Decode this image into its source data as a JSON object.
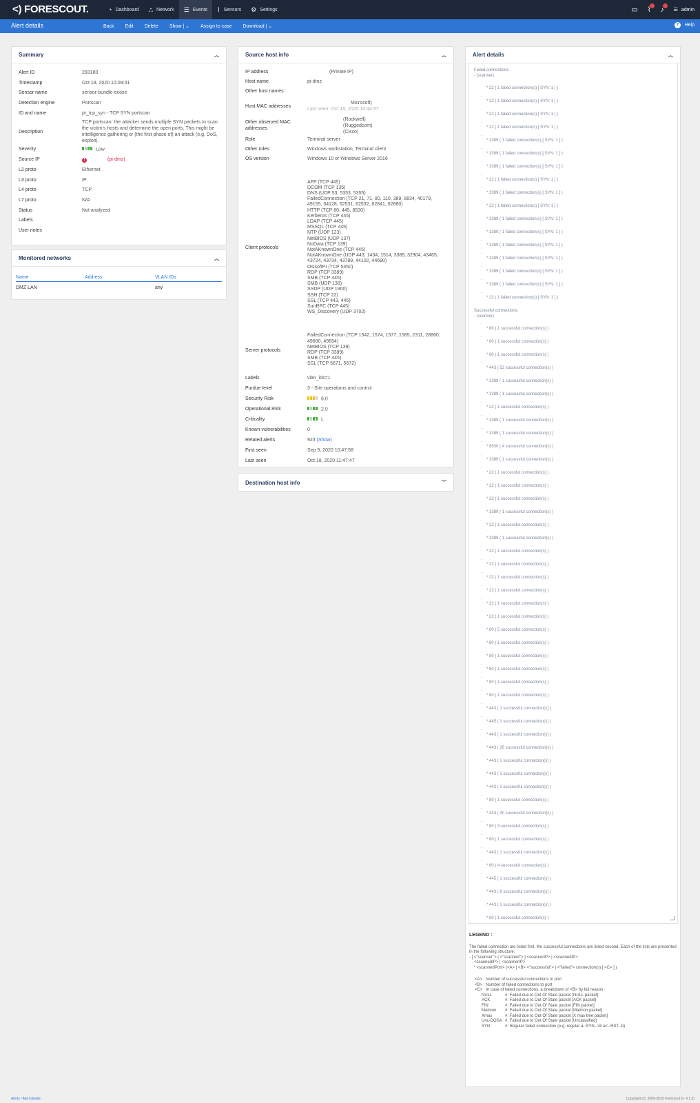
{
  "app": {
    "logo": "<) FORESCOUT."
  },
  "nav": [
    {
      "icon": "dashboard-icon",
      "glyph": "◔",
      "label": "Dashboard"
    },
    {
      "icon": "network-icon",
      "glyph": "⛬",
      "label": "Network"
    },
    {
      "icon": "events-icon",
      "glyph": "☰",
      "label": "Events",
      "active": true
    },
    {
      "icon": "sensors-icon",
      "glyph": "⌇",
      "label": "Sensors"
    },
    {
      "icon": "settings-icon",
      "glyph": "⚙",
      "label": "Settings"
    }
  ],
  "user": {
    "name": "admin"
  },
  "actionbar": {
    "title": "Alert details",
    "actions": [
      "Back",
      "Edit",
      "Delete",
      "Show | ⌄",
      "Assign to case",
      "Download | ⌄"
    ],
    "help": "Help"
  },
  "summary": {
    "title": "Summary",
    "fields": [
      {
        "k": "Alert ID",
        "v": "283180"
      },
      {
        "k": "Timestamp",
        "v": "Oct 18, 2020 10:09:41"
      },
      {
        "k": "Sensor name",
        "v": "sensor-bundle-ecose",
        "link": true
      },
      {
        "k": "Detection engine",
        "v": "Portscan"
      },
      {
        "k": "ID and name",
        "v": "pt_tcp_syn - TCP SYN portscan"
      },
      {
        "k": "Description",
        "v": "TCP portscan: the attacker sends multiple SYN packets to scan the victim's hosts and determine the open ports. This might be intelligence gathering or (the first phase of) an attack (e.g. DoS, exploit)."
      },
      {
        "k": "Severity",
        "v": "Low",
        "bars": "low"
      },
      {
        "k": "Source IP",
        "v": "(pi-dmz)",
        "danger": true
      },
      {
        "k": "L2 proto",
        "v": "Ethernet"
      },
      {
        "k": "L3 proto",
        "v": "IP"
      },
      {
        "k": "L4 proto",
        "v": "TCP"
      },
      {
        "k": "L7 proto",
        "v": "N/A"
      },
      {
        "k": "Status",
        "v": "Not analyzed"
      },
      {
        "k": "Labels",
        "v": ""
      },
      {
        "k": "User notes",
        "v": ""
      }
    ]
  },
  "monitored": {
    "title": "Monitored networks",
    "headers": [
      "Name",
      "Address",
      "VLAN IDs"
    ],
    "rows": [
      [
        "DMZ LAN",
        "",
        "any"
      ]
    ]
  },
  "source": {
    "title": "Source host info",
    "ip": "(Private IP)",
    "host": "pi-dmz",
    "mac_vendor": "Microsoft)",
    "mac_seen": "Last seen: Oct 18, 2020 10:44:57",
    "other_macs": [
      "(Rockwell)",
      "(Ruggedcom)",
      "(Cisco)"
    ],
    "role": "Terminal server",
    "other_roles": "Windows workstation, Terminal client",
    "os": "Windows 10 or Windows Server 2016",
    "client_protocols": [
      "AFP (TCP 445)",
      "DCOM (TCP 135)",
      "DNS (UDP 53, 5353, 5355)",
      "FailedConnection (TCP 21, 71, 80, 110, 389, 8834, 40179, 49155, 54128, 62531, 62532, 62841, 62880)",
      "HTTP (TCP 80, 445, 8530)",
      "Kerberos (TCP 445)",
      "LDAP (TCP 445)",
      "MSSQL (TCP 445)",
      "NTP (UDP 123)",
      "NetBIOS (UDP 137)",
      "NoData (TCP 139)",
      "NotAKnownOne (TCP 445)",
      "NotAKnownOne (UDP 443, 1434, 1514, 3389, 32904, 43465, 43724, 43734, 43789, 44102, 44690)",
      "OsisoftPI (TCP 5450)",
      "RDP (TCP 3389)",
      "SMB (TCP 445)",
      "SMB (UDP 138)",
      "SSDP (UDP 1900)",
      "SSH (TCP 22)",
      "SSL (TCP 443, 445)",
      "SunRPC (TCP 445)",
      "WS_Discovery (UDP 3702)"
    ],
    "server_protocols": [
      "FailedConnection (TCP 1542, 1574, 1577, 1585, 2311, 28860, 49680, 49694)",
      "NetBIOS (TCP 139)",
      "RDP (TCP 3389)",
      "SMB (TCP 445)",
      "SSL (TCP 5671, 5672)"
    ],
    "labels": "vlan_ids=1",
    "purdue": "3 - Site operations and control",
    "security_risk": "6.0",
    "operational_risk": "2.0",
    "criticality": "L",
    "known_vulns": "0",
    "related_alerts": "923",
    "related_show": "(Show)",
    "first_seen": "Sep 9, 2020 10:47:58",
    "last_seen": "Oct 18, 2020 11:47:47",
    "keys": {
      "ip": "IP address",
      "host": "Host name",
      "other_hosts": "Other host names",
      "mac": "Host MAC addresses",
      "other_mac": "Other observed MAC addresses",
      "role": "Role",
      "other_roles": "Other roles",
      "os": "OS version",
      "client": "Client protocols",
      "server": "Server protocols",
      "labels": "Labels",
      "purdue": "Purdue level",
      "sec": "Security Risk",
      "op": "Operational Risk",
      "crit": "Criticality",
      "vulns": "Known vulnerabilities",
      "related": "Related alerts",
      "first": "First seen",
      "last": "Last seen"
    }
  },
  "destination": {
    "title": "Destination host info"
  },
  "alert_details": {
    "title": "Alert details",
    "failed_title": "Failed connections:",
    "failed_root": "- (scanner)",
    "failed": [
      [
        "22",
        "1 failed connection(s) [ SYN: 1 ] )"
      ],
      [
        "22",
        "1 failed connection(s) [ SYN: 1 ] )"
      ],
      [
        "22",
        "1 failed connection(s) [ SYN: 1 ] )"
      ],
      [
        "22",
        "1 failed connection(s) [ SYN: 1 ] )"
      ],
      [
        "3389",
        "1 failed connection(s) [ SYN: 1 ] )"
      ],
      [
        "3389",
        "1 failed connection(s) [ SYN: 1 ] )"
      ],
      [
        "3389",
        "1 failed connection(s) [ SYN: 1 ] )"
      ],
      [
        "22",
        "1 failed connection(s) [ SYN: 1 ] )"
      ],
      [
        "3389",
        "1 failed connection(s) [ SYN: 1 ] )"
      ],
      [
        "22",
        "1 failed connection(s) [ SYN: 1 ] )"
      ],
      [
        "3389",
        "1 failed connection(s) [ SYN: 1 ] )"
      ],
      [
        "3389",
        "1 failed connection(s) [ SYN: 1 ] )"
      ],
      [
        "3389",
        "1 failed connection(s) [ SYN: 1 ] )"
      ],
      [
        "3389",
        "1 failed connection(s) [ SYN: 1 ] )"
      ],
      [
        "3389",
        "1 failed connection(s) [ SYN: 1 ] )"
      ],
      [
        "3389",
        "1 failed connection(s) [ SYN: 1 ] )"
      ],
      [
        "22",
        "1 failed connection(s) [ SYN: 1 ] )"
      ]
    ],
    "success_title": "Successful connections:",
    "success_root": "- (scanner)",
    "success": [
      [
        "80",
        "1 successful connection(s) )"
      ],
      [
        "80",
        "1 successful connection(s) )"
      ],
      [
        "80",
        "1 successful connection(s) )"
      ],
      [
        "443",
        "52 successful connection(s) )"
      ],
      [
        "3389",
        "1 successful connection(s) )"
      ],
      [
        "3389",
        "1 successful connection(s) )"
      ],
      [
        "22",
        "1 successful connection(s) )"
      ],
      [
        "3389",
        "1 successful connection(s) )"
      ],
      [
        "3389",
        "1 successful connection(s) )"
      ],
      [
        "8530",
        "4 successful connection(s) )"
      ],
      [
        "3389",
        "1 successful connection(s) )"
      ],
      [
        "22",
        "1 successful connection(s) )"
      ],
      [
        "22",
        "1 successful connection(s) )"
      ],
      [
        "22",
        "1 successful connection(s) )"
      ],
      [
        "3389",
        "1 successful connection(s) )"
      ],
      [
        "22",
        "1 successful connection(s) )"
      ],
      [
        "3389",
        "1 successful connection(s) )"
      ],
      [
        "22",
        "1 successful connection(s) )"
      ],
      [
        "22",
        "1 successful connection(s) )"
      ],
      [
        "22",
        "1 successful connection(s) )"
      ],
      [
        "22",
        "1 successful connection(s) )"
      ],
      [
        "22",
        "1 successful connection(s) )"
      ],
      [
        "22",
        "1 successful connection(s) )"
      ],
      [
        "80",
        "5 successful connection(s) )"
      ],
      [
        "80",
        "1 successful connection(s) )"
      ],
      [
        "80",
        "1 successful connection(s) )"
      ],
      [
        "80",
        "1 successful connection(s) )"
      ],
      [
        "80",
        "1 successful connection(s) )"
      ],
      [
        "80",
        "1 successful connection(s) )"
      ],
      [
        "443",
        "1 successful connection(s) )"
      ],
      [
        "445",
        "1 successful connection(s) )"
      ],
      [
        "443",
        "1 successful connection(s) )"
      ],
      [
        "443",
        "26 successful connection(s) )"
      ],
      [
        "443",
        "1 successful connection(s) )"
      ],
      [
        "443",
        "1 successful connection(s) )"
      ],
      [
        "443",
        "2 successful connection(s) )"
      ],
      [
        "80",
        "1 successful connection(s) )"
      ],
      [
        "443",
        "40 successful connection(s) )"
      ],
      [
        "80",
        "3 successful connection(s) )"
      ],
      [
        "80",
        "1 successful connection(s) )"
      ],
      [
        "443",
        "1 successful connection(s) )"
      ],
      [
        "80",
        "4 successful connection(s) )"
      ],
      [
        "445",
        "1 successful connection(s) )"
      ],
      [
        "443",
        "8 successful connection(s) )"
      ],
      [
        "443",
        "1 successful connection(s) )"
      ],
      [
        "80",
        "1 successful connection(s) )"
      ],
      [
        "80",
        "2 successful connection(s) )"
      ]
    ]
  },
  "legend": {
    "title": "LEGEND :",
    "intro": "The failed connection are listed first, the successful connections are listed second. Each of the lists are presented in the following structure:",
    "structure": [
      "- [ <\"scanner\"> | <\"scanned\"> ] <scannerIP> | <scannedIP>",
      "  - <scannedIP> | <scannerIP>",
      "    * <scannedPort> (<A> | <B> <\"successful\"> | <\"failed\"> connection(s) [ <C> ] )"
    ],
    "defs": [
      "<A> : Number of successful connections to port",
      "<B> : Number of failed connections to port",
      "<C> : In case of failed connections, a breakdown of <B> by fail reason :"
    ],
    "reasons": [
      [
        "NULL",
        "#: Failed due to Out Of State packet [NULL packet]"
      ],
      [
        "ACK",
        "#: Failed due to Out Of State packet [ACK packet]"
      ],
      [
        "FIN",
        "#: Failed due to Out Of State packet [FIN packet]"
      ],
      [
        "Maimon",
        "#: Failed due to Out Of State packet [Maimon packet]"
      ],
      [
        "Xmas",
        "#: Failed due to Out Of State packet [X mas tree packet]"
      ],
      [
        "Unc-DOSA",
        "#: Failed due to Out Of State packet [Unclassified]"
      ],
      [
        "SYN",
        "#: Regular failed connection (e.g. regular a--SYN-->b a<--RST--b)"
      ]
    ]
  },
  "footer": {
    "breadcrumb": "Alerts / Alert details",
    "copyright": "Copyright (C) 2009-2020 Forescout (v. 4.1.3)"
  }
}
